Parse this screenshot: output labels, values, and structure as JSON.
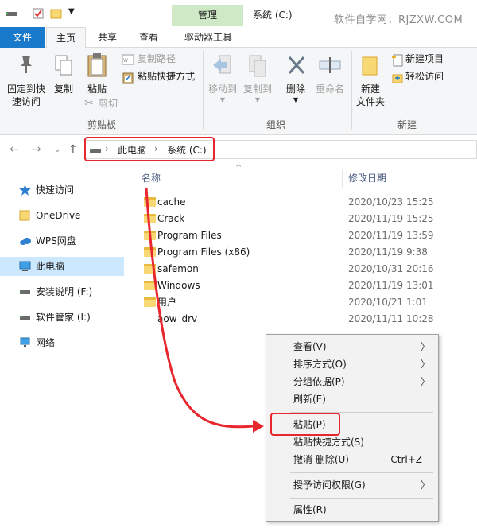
{
  "titlebar": {
    "manage_tab": "管理",
    "window_title": "系统 (C:)",
    "watermark": "软件自学网：RJZXW.COM"
  },
  "ribbon_tabs": {
    "file": "文件",
    "home": "主页",
    "share": "共享",
    "view": "查看",
    "drive_tools": "驱动器工具"
  },
  "ribbon": {
    "pin_line1": "固定到快",
    "pin_line2": "速访问",
    "copy": "复制",
    "paste": "粘贴",
    "copy_path": "复制路径",
    "paste_shortcut": "粘贴快捷方式",
    "cut": "剪切",
    "clipboard_group": "剪贴板",
    "move_to": "移动到",
    "copy_to": "复制到",
    "delete": "删除",
    "rename": "重命名",
    "organize_group": "组织",
    "new_folder_line1": "新建",
    "new_folder_line2": "文件夹",
    "new_item": "新建项目",
    "easy_access": "轻松访问",
    "new_group": "新建"
  },
  "address": {
    "crumb_pc": "此电脑",
    "crumb_drive": "系统 (C:)"
  },
  "nav": {
    "items": [
      {
        "label": "快速访问"
      },
      {
        "label": "OneDrive"
      },
      {
        "label": "WPS网盘"
      },
      {
        "label": "此电脑"
      },
      {
        "label": "安装说明 (F:)"
      },
      {
        "label": "软件管家 (I:)"
      },
      {
        "label": "网络"
      }
    ]
  },
  "files": {
    "col_name": "名称",
    "col_date": "修改日期",
    "rows": [
      {
        "name": "cache",
        "date": "2020/10/23 15:25"
      },
      {
        "name": "Crack",
        "date": "2020/11/19 15:25"
      },
      {
        "name": "Program Files",
        "date": "2020/11/19 13:59"
      },
      {
        "name": "Program Files (x86)",
        "date": "2020/11/19 9:38"
      },
      {
        "name": "safemon",
        "date": "2020/10/31 20:16"
      },
      {
        "name": "Windows",
        "date": "2020/11/19 13:01"
      },
      {
        "name": "用户",
        "date": "2020/10/21 1:01"
      },
      {
        "name": "aow_drv",
        "date": "2020/11/11 10:28"
      }
    ]
  },
  "context_menu": {
    "view": "查看(V)",
    "sort_by": "排序方式(O)",
    "group_by": "分组依据(P)",
    "refresh": "刷新(E)",
    "paste": "粘贴(P)",
    "paste_shortcut": "粘贴快捷方式(S)",
    "undo_delete": "撤消 删除(U)",
    "undo_shortcut": "Ctrl+Z",
    "grant_access": "授予访问权限(G)",
    "properties": "属性(R)"
  },
  "colors": {
    "accent_blue": "#1979ca",
    "manage_green": "#cfe8c6",
    "highlight_red": "#e8262e",
    "selection_blue": "#cce8ff"
  }
}
